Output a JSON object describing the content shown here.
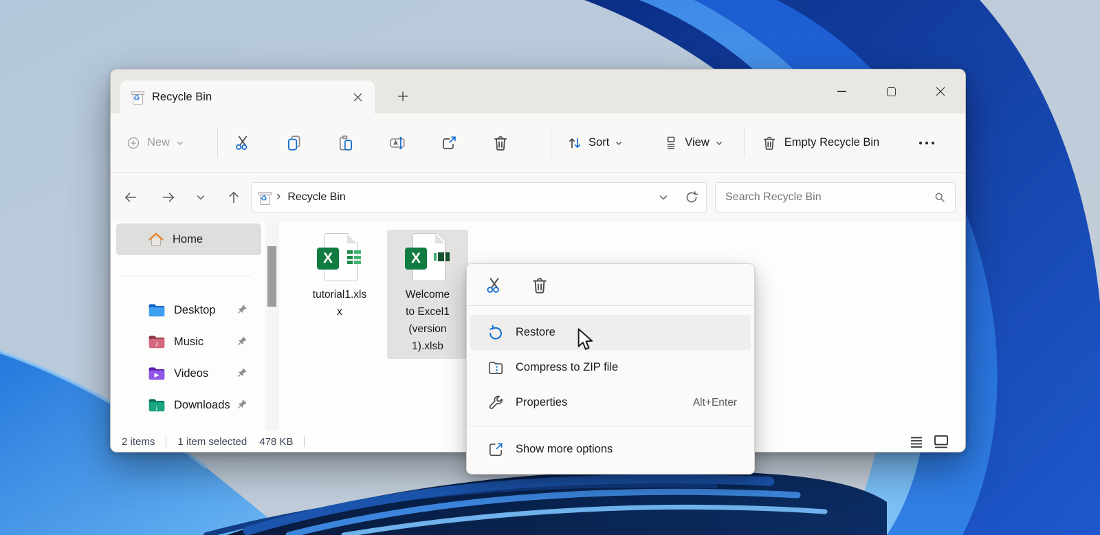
{
  "icons": {
    "recycle_symbol": "♻",
    "music_note": "♪",
    "play_glyph": "▶",
    "download_arrow": "↓",
    "excel_letter": "X",
    "breadcrumb_chevron": "›"
  },
  "window": {
    "tab_title": "Recycle Bin"
  },
  "toolbar": {
    "new_label": "New",
    "sort_label": "Sort",
    "view_label": "View",
    "empty_recycle_bin_label": "Empty Recycle Bin"
  },
  "address": {
    "location": "Recycle Bin",
    "search_placeholder": "Search Recycle Bin"
  },
  "sidebar": {
    "items": [
      {
        "label": "Home",
        "selected": true,
        "pinned": false
      },
      {
        "label": "Desktop",
        "selected": false,
        "pinned": true
      },
      {
        "label": "Music",
        "selected": false,
        "pinned": true
      },
      {
        "label": "Videos",
        "selected": false,
        "pinned": true
      },
      {
        "label": "Downloads",
        "selected": false,
        "pinned": true
      }
    ]
  },
  "files": [
    {
      "name": "tutorial1.xlsx",
      "type": "xlsx",
      "selected": false
    },
    {
      "name": "Welcome to Excel1 (version 1).xlsb",
      "type": "xlsb",
      "selected": true
    }
  ],
  "context_menu": {
    "items": [
      {
        "label": "Restore",
        "hovered": true
      },
      {
        "label": "Compress to ZIP file"
      },
      {
        "label": "Properties",
        "shortcut": "Alt+Enter"
      },
      {
        "label": "Show more options"
      }
    ]
  },
  "status_bar": {
    "item_count": "2 items",
    "selection_count": "1 item selected",
    "selection_size": "478 KB"
  },
  "colors": {
    "accent_blue": "#0f6cce",
    "excel_green": "#107c41",
    "selection_highlight": "#e3e2e0"
  }
}
